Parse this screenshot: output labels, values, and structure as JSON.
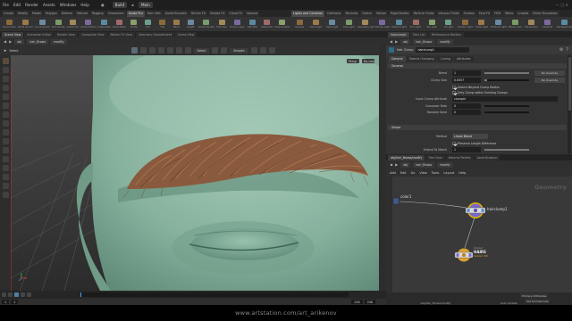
{
  "menu": [
    "File",
    "Edit",
    "Render",
    "Assets",
    "Windows",
    "Help"
  ],
  "build_label": "Build",
  "desktop_label": "Main",
  "shelf_tabs_left": [
    "Create",
    "Modify",
    "Model",
    "Polygon",
    "Deform",
    "Texture",
    "Rigging",
    "Characters",
    "Guide Pro",
    "Hair Utils",
    "Guide Brushes",
    "Terrain FX",
    "Simple FX",
    "Cloud FX",
    "Volume"
  ],
  "shelf_tabs_left_active": 8,
  "shelf_tabs_right": [
    "Lights and Cameras",
    "Collisions",
    "Particles",
    "Grains",
    "Vellum",
    "Rigid Bodies",
    "Particle Fluids",
    "Viscous Fluids",
    "Oceans",
    "Pyro FX",
    "FEM",
    "Wires",
    "Crowds",
    "Drive Simulation"
  ],
  "shelf_tabs_right_active": 0,
  "tools_left": [
    "Groom Geo",
    "Guide Groom",
    "Curve Groom",
    "Add Guides",
    "Groom Fur",
    "Guide Deform",
    "Interpolate",
    "Guide Mask",
    "Clump",
    "Curl",
    "Frizz",
    "Bend",
    "Length",
    "Guide Process",
    "Hair Gen",
    "Groom Layer",
    "Set Attrs",
    "Guide Sim",
    "Draw Guides"
  ],
  "tools_right": [
    "Camera",
    "Point Light",
    "Spot Light",
    "Area Light",
    "Geometry Light",
    "Volume Light",
    "Distant Light",
    "Env Light",
    "Sky Light",
    "GI Light",
    "Caustic Light",
    "Portal Light",
    "Ambient Light",
    "Stereo Cam",
    "VR Camera",
    "Switcher",
    "Gamepad Cam"
  ],
  "pane_tabs_left": [
    "Scene View",
    "Animation Editor",
    "Render View",
    "Composite View",
    "Motion FX View",
    "Geometry Spreadsheet",
    "Scene View"
  ],
  "pane_tabs_left_active": 0,
  "pane_tabs_right": [
    "hairclump1",
    "Take List",
    "Performance Monitor"
  ],
  "pane_tabs_right_active": 0,
  "path_left": [
    "obj",
    "hair_Brows",
    "modify"
  ],
  "path_right": [
    "obj",
    "hair_Brows",
    "modify"
  ],
  "viewport": {
    "tool_label": "Select",
    "select_dd": "Select",
    "display_dd": "Smooth",
    "persp_label": "Persp",
    "cam_label": "No cam"
  },
  "timeline": {
    "start": "1",
    "end": "240",
    "current": "1",
    "range_end": "240"
  },
  "params": {
    "node_type": "Hair Clump",
    "node_name": "hairclump1",
    "tabs": [
      "General",
      "Tutorial Clumping",
      "Curling",
      "Attributes"
    ],
    "active_tab": 0,
    "section_general": "General",
    "blend_label": "Blend",
    "blend_value": "1",
    "clump_size_label": "Clump Size",
    "clump_size_value": "0.0057",
    "no_override": "No Override",
    "check_beyond": "Search Beyond Clump Radius",
    "check_existing": "Only Clump within Existing Clumps",
    "input_attr_label": "Input Clump Attribute",
    "input_attr_value": "clumpid",
    "crossover_label": "Crossover Rate",
    "crossover_value": "0",
    "random_seed_label": "Random Seed",
    "random_seed_value": "0",
    "section_shape": "Shape",
    "method_label": "Method",
    "method_value": "Linear Blend",
    "preserve_length": "Preserve Length Difference",
    "extend_label": "Extend To Match",
    "extend_value": "1"
  },
  "network": {
    "tabs": [
      "obj/hair_Brows/modify",
      "Tree View",
      "Material Palette",
      "Asset Browser"
    ],
    "active_tab": 0,
    "menu": [
      "Add",
      "Edit",
      "Go",
      "View",
      "Tools",
      "Layout",
      "Help"
    ],
    "watermark": "Geometry",
    "nodes": [
      {
        "name": "color1",
        "sub": ""
      },
      {
        "name": "hairclump1",
        "sub": ""
      },
      {
        "name": "HAIRS",
        "sub": "Output #0",
        "top": "Output"
      }
    ],
    "bottom_fields": [
      "Primary Attributes",
      "Set All Channels",
      "Auto Update",
      "/obj/hair_Brows/modify"
    ]
  },
  "credit": "www.artstation.com/art_arikenov",
  "colors": {
    "skin": "#8fb8a3",
    "hair": "#8a5a3e",
    "node_select": "#f0c000",
    "node_orange": "#d9a233",
    "node_violet": "#7a68c8"
  }
}
